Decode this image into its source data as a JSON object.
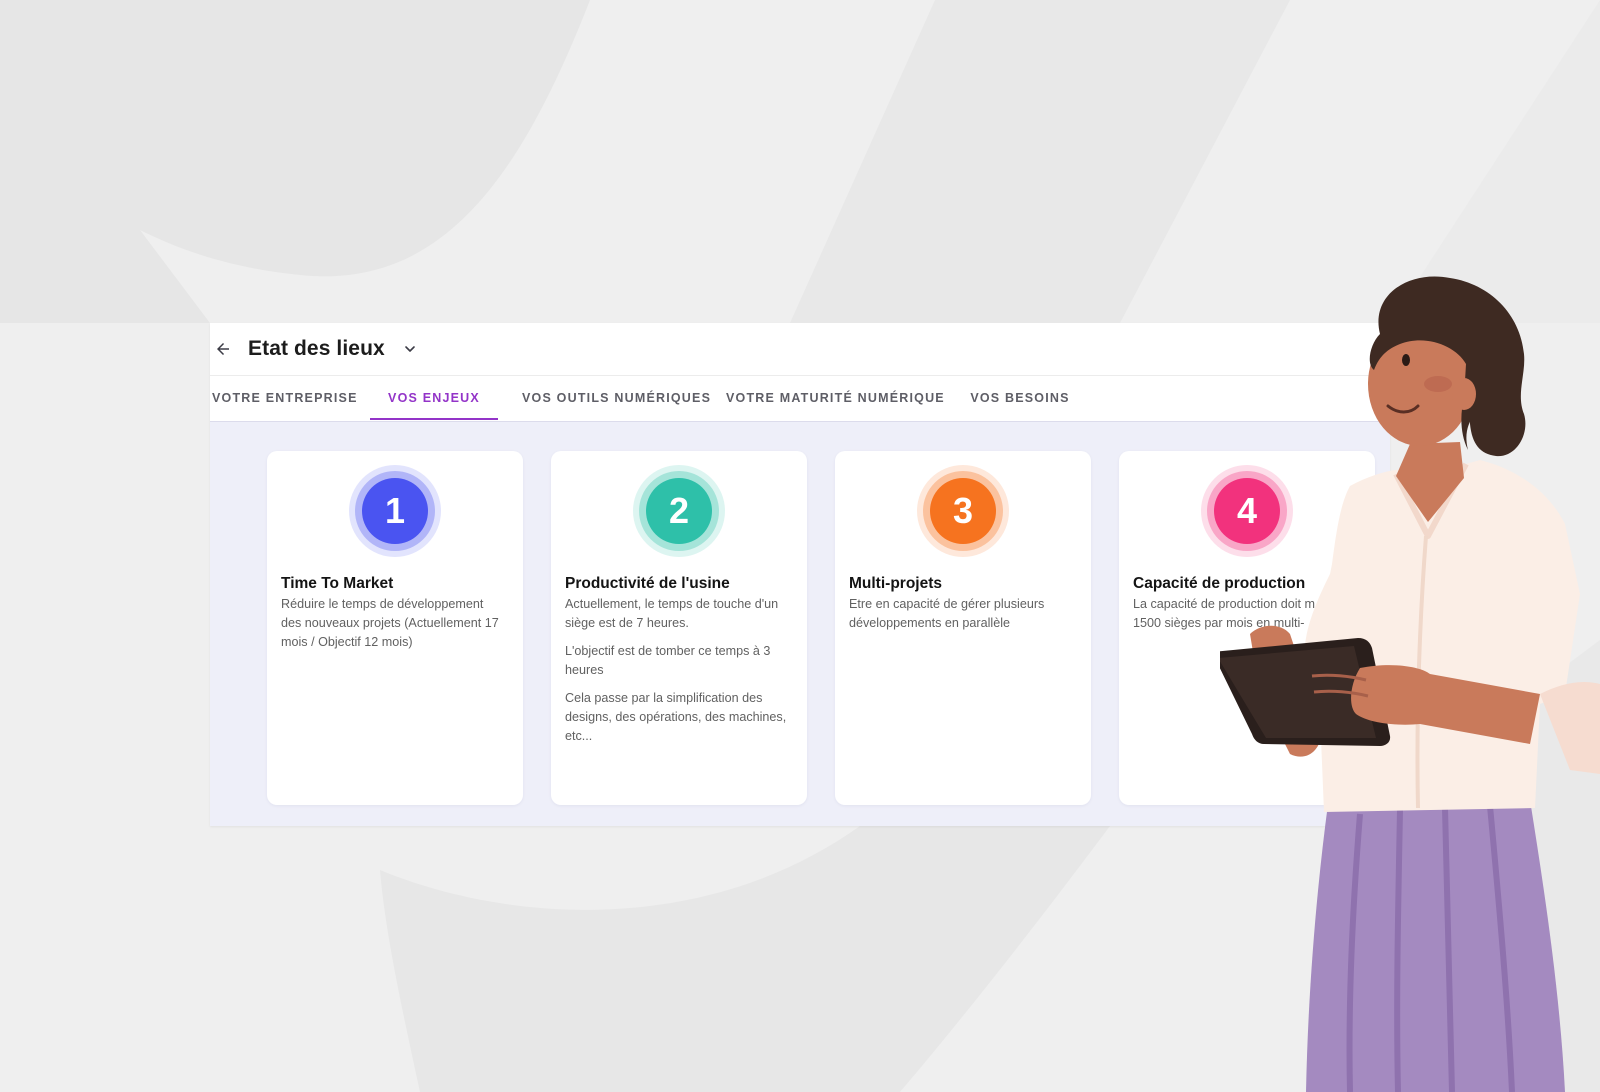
{
  "header": {
    "title": "Etat des lieux"
  },
  "tabs": [
    {
      "label": "VOTRE ENTREPRISE",
      "active": false
    },
    {
      "label": "VOS ENJEUX",
      "active": true
    },
    {
      "label": "VOS OUTILS NUMÉRIQUES",
      "active": false
    },
    {
      "label": "VOTRE MATURITÉ NUMÉRIQUE",
      "active": false
    },
    {
      "label": "VOS BESOINS",
      "active": false
    }
  ],
  "cards": [
    {
      "number": "1",
      "color": "#4a54f1",
      "title": "Time To Market",
      "paragraphs": [
        "Réduire le temps de développement des nouveaux projets (Actuellement 17 mois / Objectif 12 mois)"
      ]
    },
    {
      "number": "2",
      "color": "#2ec0a9",
      "title": "Productivité de l'usine",
      "paragraphs": [
        "Actuellement, le temps de touche d'un siège est de 7 heures.",
        "L'objectif est de tomber ce temps à 3 heures",
        "Cela passe par la simplification des designs, des opérations, des machines, etc..."
      ]
    },
    {
      "number": "3",
      "color": "#f6731f",
      "title": "Multi-projets",
      "paragraphs": [
        "Etre en capacité de gérer plusieurs développements en parallèle"
      ]
    },
    {
      "number": "4",
      "color": "#f2327d",
      "title": "Capacité de production",
      "paragraphs": [
        "La capacité de production doit m",
        "1500 sièges par mois en multi-"
      ]
    }
  ],
  "colors": {
    "accent": "#9334c8",
    "panel_bg": "#eeeff9",
    "page_bg": "#efefef"
  },
  "icons": {
    "back": "arrow-left-icon",
    "dropdown": "chevron-down-icon"
  }
}
